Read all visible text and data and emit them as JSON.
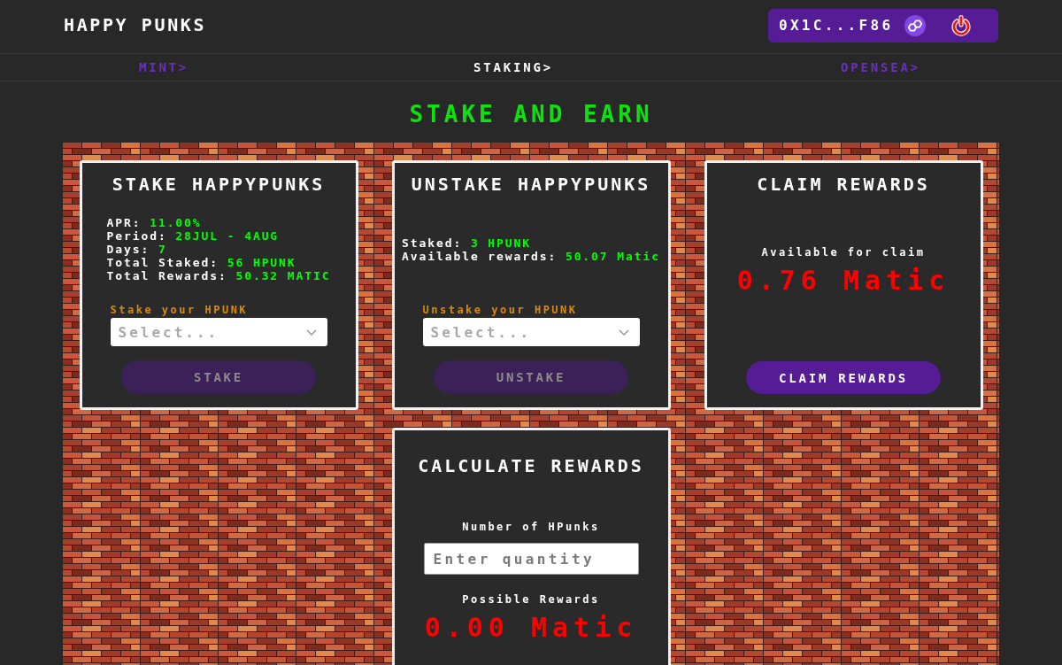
{
  "header": {
    "title": "HAPPY PUNKS",
    "wallet": {
      "address": "0X1C...F86"
    }
  },
  "nav": [
    {
      "label": "MINT>",
      "selected": false
    },
    {
      "label": "STAKING>",
      "selected": true
    },
    {
      "label": "OPENSEA>",
      "selected": false
    }
  ],
  "heading": "STAKE AND EARN",
  "cards": [
    {
      "kind": "stake",
      "title": "STAKE HAPPYPUNKS",
      "stats": [
        {
          "label": "APR:",
          "value": "11.00%"
        },
        {
          "label": "Period:",
          "value": "28JUL - 4AUG"
        },
        {
          "label": "Days:",
          "value": "7"
        },
        {
          "label": "Total Staked:",
          "value": "56 HPUNK"
        },
        {
          "label": "Total Rewards:",
          "value": "50.32 MATIC"
        }
      ],
      "select": {
        "label": "Stake your HPUNK",
        "placeholder": "Select..."
      },
      "button": {
        "label": "STAKE",
        "disabled": true
      }
    },
    {
      "kind": "stake",
      "title": "UNSTAKE HAPPYPUNKS",
      "stats": [
        {
          "label": "Staked:",
          "value": "3 HPUNK"
        },
        {
          "label": "Available rewards:",
          "value": "50.07 Matic"
        }
      ],
      "select": {
        "label": "Unstake your HPUNK",
        "placeholder": "Select..."
      },
      "button": {
        "label": "UNSTAKE",
        "disabled": true
      }
    },
    {
      "kind": "claim",
      "title": "CLAIM REWARDS",
      "caption": "Available for claim",
      "amount": "0.76 Matic",
      "button": {
        "label": "CLAIM REWARDS",
        "disabled": false
      }
    },
    {
      "kind": "calculate",
      "title": "CALCULATE REWARDS",
      "input": {
        "label": "Number of HPunks",
        "placeholder": "Enter quantity"
      },
      "caption": "Possible Rewards",
      "amount": "0.00 Matic"
    }
  ]
}
